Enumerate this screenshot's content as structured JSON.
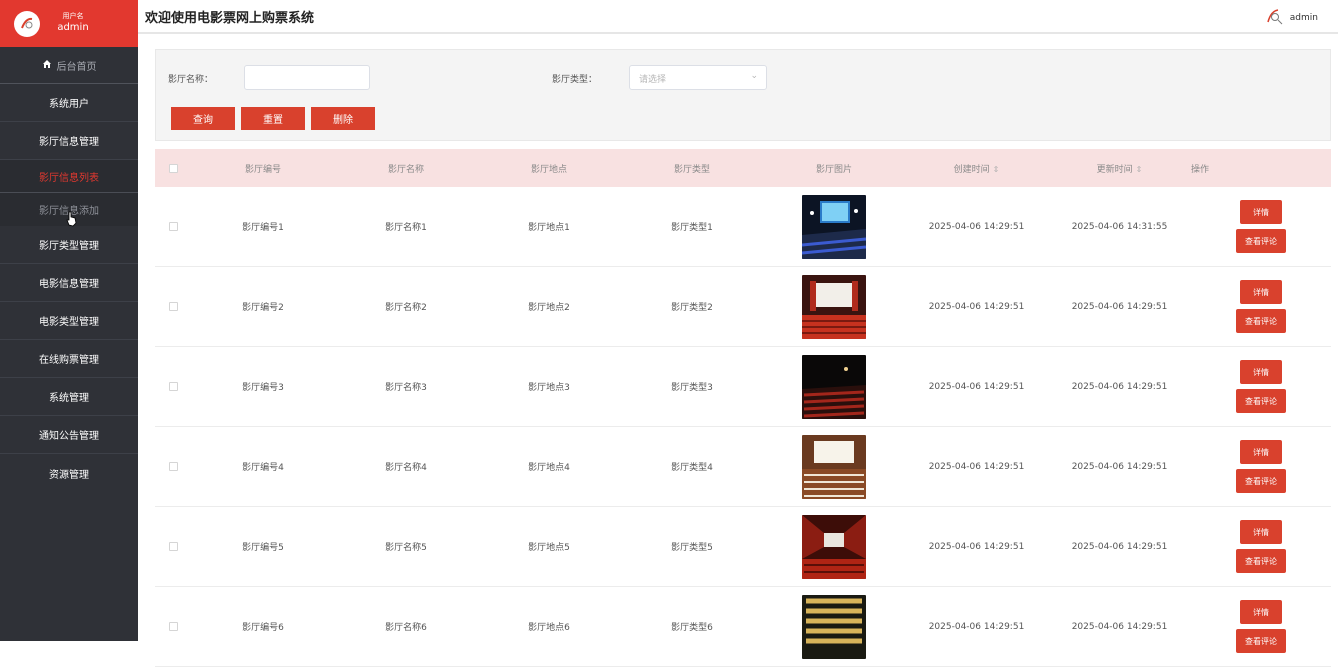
{
  "sidebar": {
    "user_label": "用户名",
    "user_name": "admin",
    "home": "后台首页",
    "items": [
      {
        "label": "系统用户"
      },
      {
        "label": "影厅信息管理"
      },
      {
        "label": "影厅信息列表"
      },
      {
        "label": "影厅信息添加"
      },
      {
        "label": "影厅类型管理"
      },
      {
        "label": "电影信息管理"
      },
      {
        "label": "电影类型管理"
      },
      {
        "label": "在线购票管理"
      },
      {
        "label": "系统管理"
      },
      {
        "label": "通知公告管理"
      },
      {
        "label": "资源管理"
      }
    ]
  },
  "header": {
    "title": "欢迎使用电影票网上购票系统",
    "user": "admin"
  },
  "search": {
    "name_label": "影厅名称：",
    "type_label": "影厅类型：",
    "type_placeholder": "请选择",
    "query_btn": "查询",
    "reset_btn": "重置",
    "delete_btn": "删除"
  },
  "table": {
    "headers": {
      "no": "影厅编号",
      "name": "影厅名称",
      "addr": "影厅地点",
      "type": "影厅类型",
      "img": "影厅图片",
      "ct": "创建时间",
      "ut": "更新时间",
      "op": "操作"
    },
    "detail_btn": "详情",
    "review_btn": "查看评论",
    "rows": [
      {
        "no": "影厅编号1",
        "name": "影厅名称1",
        "addr": "影厅地点1",
        "type": "影厅类型1",
        "ct": "2025-04-06 14:29:51",
        "ut": "2025-04-06 14:31:55"
      },
      {
        "no": "影厅编号2",
        "name": "影厅名称2",
        "addr": "影厅地点2",
        "type": "影厅类型2",
        "ct": "2025-04-06 14:29:51",
        "ut": "2025-04-06 14:29:51"
      },
      {
        "no": "影厅编号3",
        "name": "影厅名称3",
        "addr": "影厅地点3",
        "type": "影厅类型3",
        "ct": "2025-04-06 14:29:51",
        "ut": "2025-04-06 14:29:51"
      },
      {
        "no": "影厅编号4",
        "name": "影厅名称4",
        "addr": "影厅地点4",
        "type": "影厅类型4",
        "ct": "2025-04-06 14:29:51",
        "ut": "2025-04-06 14:29:51"
      },
      {
        "no": "影厅编号5",
        "name": "影厅名称5",
        "addr": "影厅地点5",
        "type": "影厅类型5",
        "ct": "2025-04-06 14:29:51",
        "ut": "2025-04-06 14:29:51"
      },
      {
        "no": "影厅编号6",
        "name": "影厅名称6",
        "addr": "影厅地点6",
        "type": "影厅类型6",
        "ct": "2025-04-06 14:29:51",
        "ut": "2025-04-06 14:29:51"
      }
    ]
  },
  "colors": {
    "accent": "#e2382f",
    "sidebar_bg": "#2f3137",
    "table_header_bg": "#f8e1e1"
  }
}
